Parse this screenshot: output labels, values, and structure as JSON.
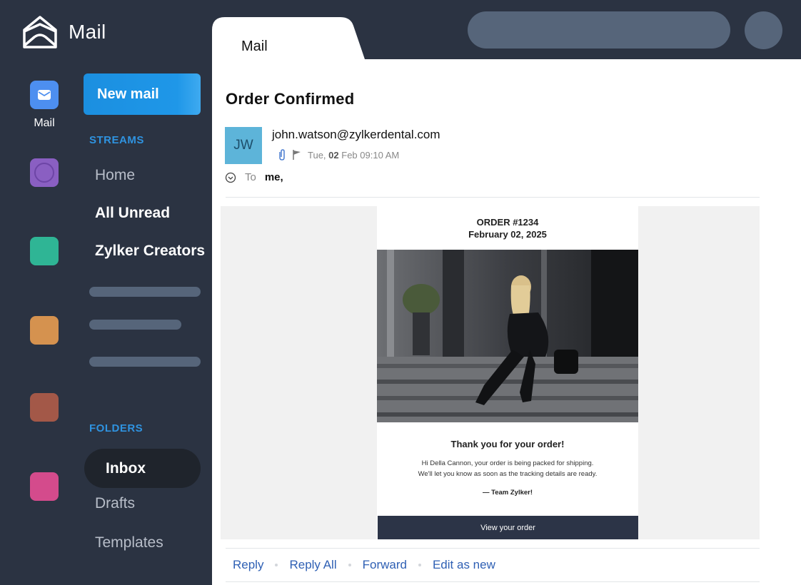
{
  "app": {
    "title": "Mail",
    "logo_icon": "envelope-house-icon"
  },
  "rail": {
    "mail_label": "Mail",
    "colors": {
      "mail": "#4d8ff0",
      "purple": "#8a5fc2",
      "green": "#2fb595",
      "orange": "#d5924f",
      "brown": "#a35848",
      "pink": "#d44b8c"
    }
  },
  "sidebar": {
    "new_mail_label": "New mail",
    "streams_label": "STREAMS",
    "streams": [
      "Home",
      "All Unread",
      "Zylker Creators"
    ],
    "folders_label": "FOLDERS",
    "folders": [
      "Inbox",
      "Drafts",
      "Templates"
    ],
    "active_folder": "Inbox"
  },
  "tab": {
    "label": "Mail"
  },
  "email": {
    "subject": "Order Confirmed",
    "sender_initials": "JW",
    "sender_email": "john.watson@zylkerdental.com",
    "date_day": "Tue,",
    "date_bold": "02",
    "date_rest": "Feb 09:10 AM",
    "to_label": "To",
    "to_value": "me,",
    "body": {
      "order_number": "ORDER #1234",
      "order_date": "February 02, 2025",
      "thanks": "Thank you for your order!",
      "message_line1": "Hi Della Cannon, your order is being packed for shipping.",
      "message_line2": "We'll let you know as soon as the tracking details are ready.",
      "signature": "— Team Zylker!",
      "cta_label": "View your order"
    }
  },
  "actions": [
    "Reply",
    "Reply All",
    "Forward",
    "Edit as new"
  ]
}
